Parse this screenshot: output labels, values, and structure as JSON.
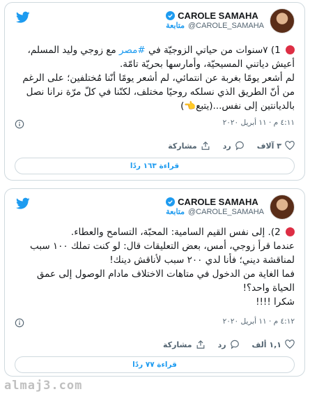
{
  "colors": {
    "accent": "#1d9bf0",
    "text": "#14171a",
    "muted": "#536471",
    "red_dot": "#dd2e44"
  },
  "tweets": [
    {
      "author": {
        "display_name": "CAROLE SAMAHA",
        "handle": "@CAROLE_SAMAHA",
        "follow_label": "متابعة",
        "verified": true
      },
      "text": {
        "number": "1)",
        "line1_before": "٧سنوات من حياتي الزوجيّة في",
        "hashtag": "#مصر",
        "line1_after": "مع زوجي وليد المسلم، أعيش دياتني المسيحيّة، وأمارسها بحريّة تامّة.",
        "line2": "لم أشعر يومًا بغربة عن انتمائي، لم أشعر يومًا أنّنا مُختلفين؛ على الرغم من أنّ الطريق الذي نسلكه روحيًا مختلف، لكنّنا في كلّ مرّة نرانا نصل بالديانتين إلى نفس...(يتبع👈)"
      },
      "timestamp": "٤:١١ م · ١١ أبريل ٢٠٢٠",
      "actions": {
        "likes": "٣ آلاف",
        "reply": "رد",
        "share": "مشاركة"
      },
      "read_label": "قراءة ١٦٣ ردًا"
    },
    {
      "author": {
        "display_name": "CAROLE SAMAHA",
        "handle": "@CAROLE_SAMAHA",
        "follow_label": "متابعة",
        "verified": true
      },
      "text": {
        "number": "2).",
        "line1": "إلى نفس القيم السامية: المحبّة، التسامح والعطاء.",
        "line2": "عندما قرأ زوجي، أمس، بعض التعليقات قال: لو كنت تملك ١٠٠ سبب لمناقشة ديني؛ فأنا لدي ٢٠٠ سبب لأناقش دينك!",
        "line3": "فما الغاية من الدخول في متاهات الاختلاف مادام الوصول إلى عمق الحياة واحد؟!",
        "line4": "شكرا !!!!"
      },
      "timestamp": "٤:١٢ م · ١١ أبريل ٢٠٢٠",
      "actions": {
        "likes": "١,١ ألف",
        "reply": "رد",
        "share": "مشاركة"
      },
      "read_label": "قراءة ٧٧ ردًا"
    }
  ],
  "watermark": "almaj3.com"
}
